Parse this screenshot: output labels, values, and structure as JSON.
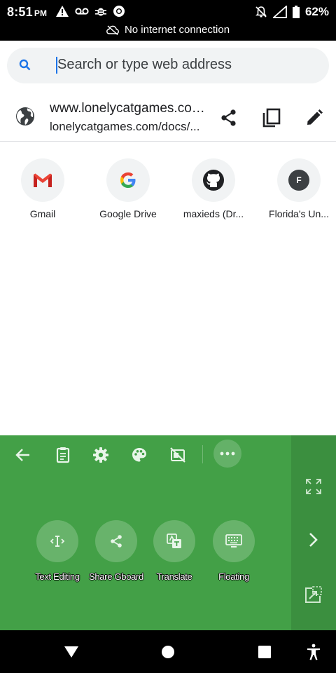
{
  "status_bar": {
    "time": "8:51",
    "ampm": "PM",
    "battery": "62%",
    "offline_message": "No internet connection"
  },
  "search": {
    "placeholder": "Search or type web address"
  },
  "page_info": {
    "title": "www.lonelycatgames.com/docs/...",
    "url": "lonelycatgames.com/docs/..."
  },
  "shortcuts": [
    {
      "label": "Gmail",
      "icon": "gmail-icon"
    },
    {
      "label": "Google Drive",
      "icon": "google-icon"
    },
    {
      "label": "maxieds (Dr...",
      "icon": "github-icon"
    },
    {
      "label": "Florida's Un...",
      "icon": "letter-f-icon",
      "letter": "F"
    }
  ],
  "keyboard": {
    "tools": [
      {
        "label": "Text Editing",
        "icon": "text-cursor-icon"
      },
      {
        "label": "Share Gboard",
        "icon": "share-icon"
      },
      {
        "label": "Translate",
        "icon": "translate-icon"
      },
      {
        "label": "Floating",
        "icon": "keyboard-icon"
      }
    ],
    "colors": {
      "background": "#43a047",
      "side_panel": "#3b8f3f"
    }
  },
  "colors": {
    "accent": "#1a73e8",
    "gmail_red": "#ea4335"
  }
}
